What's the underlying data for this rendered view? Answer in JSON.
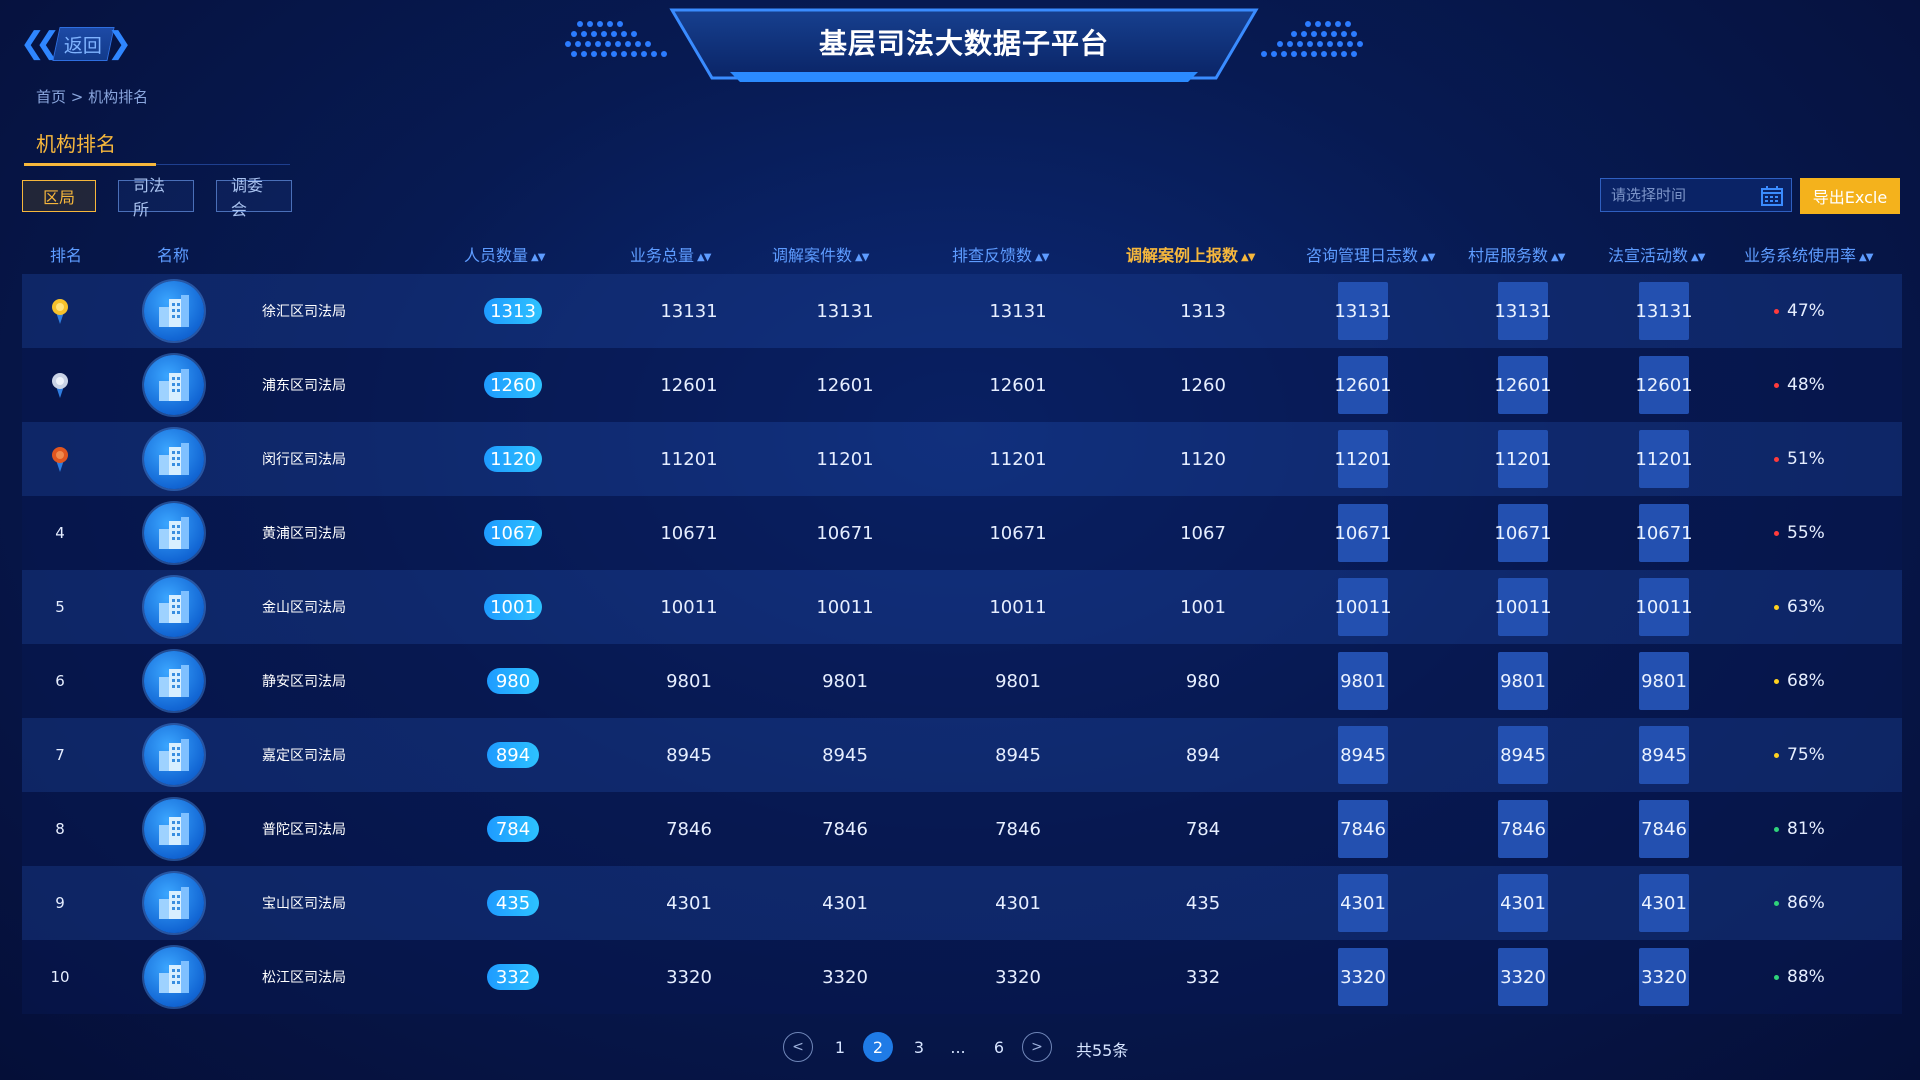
{
  "header": {
    "back_label": "返回",
    "title": "基层司法大数据子平台"
  },
  "breadcrumb": "首页 > 机构排名",
  "section_title": "机构排名",
  "filters": [
    "区局",
    "司法所",
    "调委会"
  ],
  "date_placeholder": "请选择时间",
  "export_label": "导出Excle",
  "columns": [
    "排名",
    "名称",
    "人员数量",
    "业务总量",
    "调解案件数",
    "排查反馈数",
    "调解案例上报数",
    "咨询管理日志数",
    "村居服务数",
    "法宣活动数",
    "业务系统使用率"
  ],
  "rows": [
    {
      "rank": "",
      "medal": "gold",
      "name": "徐汇区司法局",
      "staff": "1313",
      "total": "13131",
      "mediation": "13131",
      "feedback": "13131",
      "cases": "1313",
      "consult": "13131",
      "village": "13131",
      "promo": "13131",
      "rate": "47%",
      "rate_color": "#ff3b3b"
    },
    {
      "rank": "",
      "medal": "silver",
      "name": "浦东区司法局",
      "staff": "1260",
      "total": "12601",
      "mediation": "12601",
      "feedback": "12601",
      "cases": "1260",
      "consult": "12601",
      "village": "12601",
      "promo": "12601",
      "rate": "48%",
      "rate_color": "#ff3b3b"
    },
    {
      "rank": "",
      "medal": "bronze",
      "name": "闵行区司法局",
      "staff": "1120",
      "total": "11201",
      "mediation": "11201",
      "feedback": "11201",
      "cases": "1120",
      "consult": "11201",
      "village": "11201",
      "promo": "11201",
      "rate": "51%",
      "rate_color": "#ff3b3b"
    },
    {
      "rank": "4",
      "medal": "",
      "name": "黄浦区司法局",
      "staff": "1067",
      "total": "10671",
      "mediation": "10671",
      "feedback": "10671",
      "cases": "1067",
      "consult": "10671",
      "village": "10671",
      "promo": "10671",
      "rate": "55%",
      "rate_color": "#ff3b3b"
    },
    {
      "rank": "5",
      "medal": "",
      "name": "金山区司法局",
      "staff": "1001",
      "total": "10011",
      "mediation": "10011",
      "feedback": "10011",
      "cases": "1001",
      "consult": "10011",
      "village": "10011",
      "promo": "10011",
      "rate": "63%",
      "rate_color": "#ffd21f"
    },
    {
      "rank": "6",
      "medal": "",
      "name": "静安区司法局",
      "staff": "980",
      "total": "9801",
      "mediation": "9801",
      "feedback": "9801",
      "cases": "980",
      "consult": "9801",
      "village": "9801",
      "promo": "9801",
      "rate": "68%",
      "rate_color": "#ffd21f"
    },
    {
      "rank": "7",
      "medal": "",
      "name": "嘉定区司法局",
      "staff": "894",
      "total": "8945",
      "mediation": "8945",
      "feedback": "8945",
      "cases": "894",
      "consult": "8945",
      "village": "8945",
      "promo": "8945",
      "rate": "75%",
      "rate_color": "#ffd21f"
    },
    {
      "rank": "8",
      "medal": "",
      "name": "普陀区司法局",
      "staff": "784",
      "total": "7846",
      "mediation": "7846",
      "feedback": "7846",
      "cases": "784",
      "consult": "7846",
      "village": "7846",
      "promo": "7846",
      "rate": "81%",
      "rate_color": "#2fd37a"
    },
    {
      "rank": "9",
      "medal": "",
      "name": "宝山区司法局",
      "staff": "435",
      "total": "4301",
      "mediation": "4301",
      "feedback": "4301",
      "cases": "435",
      "consult": "4301",
      "village": "4301",
      "promo": "4301",
      "rate": "86%",
      "rate_color": "#2fd37a"
    },
    {
      "rank": "10",
      "medal": "",
      "name": "松江区司法局",
      "staff": "332",
      "total": "3320",
      "mediation": "3320",
      "feedback": "3320",
      "cases": "332",
      "consult": "3320",
      "village": "3320",
      "promo": "3320",
      "rate": "88%",
      "rate_color": "#2fd37a"
    }
  ],
  "pagination": {
    "prev": "<",
    "pages": [
      "1",
      "2",
      "3",
      "...",
      "6"
    ],
    "current": "2",
    "next": ">",
    "total_label": "共55条"
  },
  "colors": {
    "accent": "#f6b73c",
    "header_blue": "#5e9cff",
    "pill": "#1e9bff",
    "box": "#2350b0"
  }
}
